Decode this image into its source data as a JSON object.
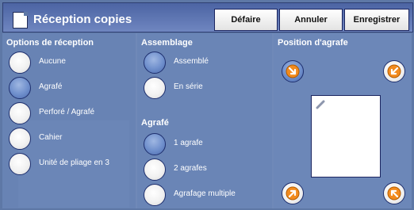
{
  "header": {
    "title": "Réception copies",
    "buttons": {
      "undo": "Défaire",
      "cancel": "Annuler",
      "save": "Enregistrer"
    }
  },
  "reception_options": {
    "label": "Options de réception",
    "items": [
      {
        "label": "Aucune",
        "selected": false
      },
      {
        "label": "Agrafé",
        "selected": true
      },
      {
        "label": "Perforé / Agrafé",
        "selected": false
      },
      {
        "label": "Cahier",
        "selected": false
      },
      {
        "label": "Unité de pliage en 3",
        "selected": false
      }
    ]
  },
  "collation": {
    "label": "Assemblage",
    "items": [
      {
        "label": "Assemblé",
        "selected": true
      },
      {
        "label": "En série",
        "selected": false
      }
    ]
  },
  "stapling": {
    "label": "Agrafé",
    "items": [
      {
        "label": "1 agrafe",
        "selected": true
      },
      {
        "label": "2 agrafes",
        "selected": false
      },
      {
        "label": "Agrafage multiple",
        "selected": false
      }
    ]
  },
  "staple_position": {
    "label": "Position d'agrafe",
    "selected": "top-left",
    "positions": [
      "top-left",
      "top-right",
      "bottom-left",
      "bottom-right"
    ]
  },
  "colors": {
    "accent": "#6f8fcc",
    "panel": "#6883b4",
    "outline": "#1e2f6e",
    "arrow": "#f28b1e"
  }
}
